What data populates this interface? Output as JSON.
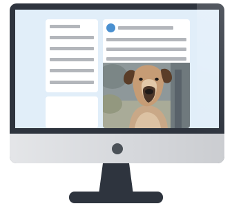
{
  "illustration": {
    "screen_color": "#e1eef9",
    "frame_color": "#2e343e",
    "chin_color": "#d6d8dc",
    "accent_color": "#4a90d0",
    "placeholder_line_color": "#b3b6bb"
  },
  "sidebar": {
    "card_top": {
      "placeholder_lines": 6
    },
    "card_bottom": {
      "placeholder_lines": 0
    }
  },
  "post": {
    "avatar_icon": "user-avatar-dot",
    "placeholder_lines": 3,
    "photo_subject": "dog-photo"
  }
}
